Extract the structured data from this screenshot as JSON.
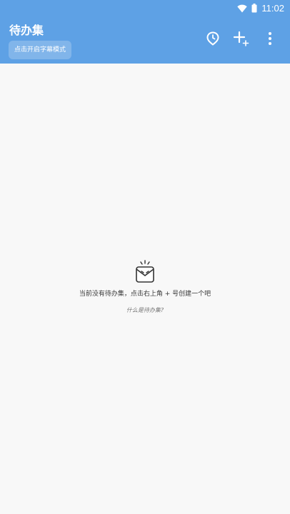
{
  "status_bar": {
    "time": "11:02",
    "icons": [
      "wifi-icon",
      "battery-icon"
    ]
  },
  "header": {
    "title": "待办集",
    "mode_button_label": "点击开启字幕模式",
    "actions": [
      "reminder-icon",
      "add-icon",
      "more-icon"
    ],
    "background_color": "#5ea1e5"
  },
  "empty_state": {
    "icon": "empty-box-icon",
    "message": "当前没有待办集，点击右上角 + 号创建一个吧",
    "help_link": "什么是待办集?"
  }
}
